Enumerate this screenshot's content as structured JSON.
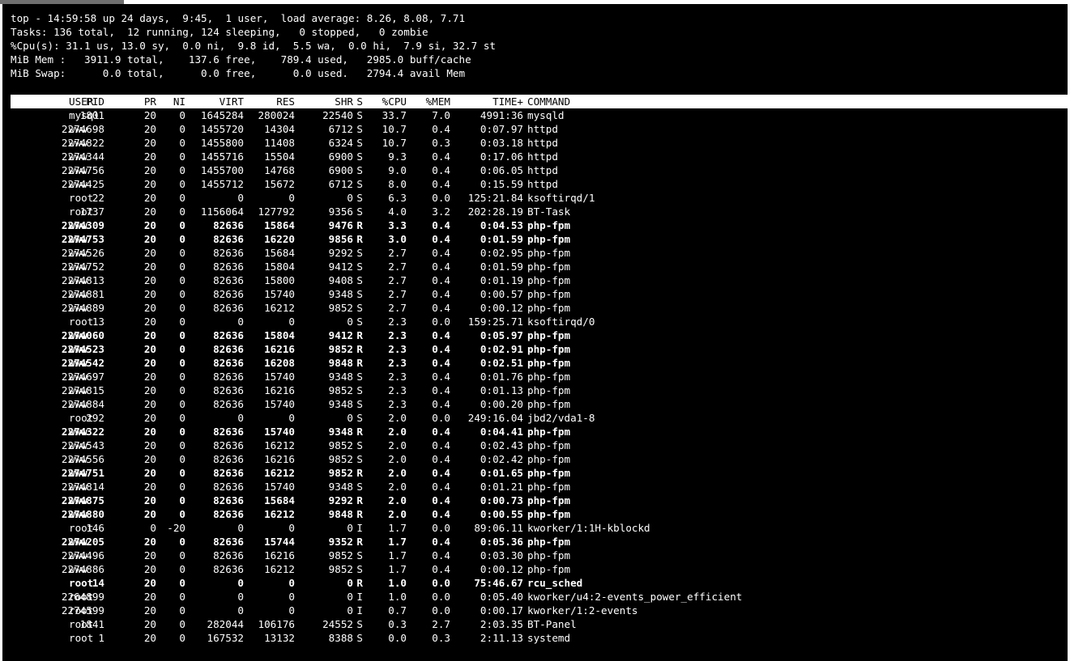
{
  "summary": {
    "uptime_line": "top - 14:59:58 up 24 days,  9:45,  1 user,  load average: 8.26, 8.08, 7.71",
    "tasks_line": "Tasks: 136 total,  12 running, 124 sleeping,   0 stopped,   0 zombie",
    "cpu_line": "%Cpu(s): 31.1 us, 13.0 sy,  0.0 ni,  9.8 id,  5.5 wa,  0.0 hi,  7.9 si, 32.7 st",
    "mem_line": "MiB Mem :   3911.9 total,    137.6 free,    789.4 used,   2985.0 buff/cache",
    "swap_line": "MiB Swap:      0.0 total,      0.0 free,      0.0 used.   2794.4 avail Mem"
  },
  "columns": {
    "pid": "PID",
    "user": "USER",
    "pr": "PR",
    "ni": "NI",
    "virt": "VIRT",
    "res": "RES",
    "shr": "SHR",
    "s": "S",
    "cpu": "%CPU",
    "mem": "%MEM",
    "time": "TIME+",
    "command": "COMMAND"
  },
  "processes": [
    {
      "pid": "1801",
      "user": "mysql",
      "pr": "20",
      "ni": "0",
      "virt": "1645284",
      "res": "280024",
      "shr": "22540",
      "s": "S",
      "cpu": "33.7",
      "mem": "7.0",
      "time": "4991:36",
      "command": "mysqld"
    },
    {
      "pid": "2274698",
      "user": "www",
      "pr": "20",
      "ni": "0",
      "virt": "1455720",
      "res": "14304",
      "shr": "6712",
      "s": "S",
      "cpu": "10.7",
      "mem": "0.4",
      "time": "0:07.97",
      "command": "httpd"
    },
    {
      "pid": "2274822",
      "user": "www",
      "pr": "20",
      "ni": "0",
      "virt": "1455800",
      "res": "11408",
      "shr": "6324",
      "s": "S",
      "cpu": "10.7",
      "mem": "0.3",
      "time": "0:03.18",
      "command": "httpd"
    },
    {
      "pid": "2274344",
      "user": "www",
      "pr": "20",
      "ni": "0",
      "virt": "1455716",
      "res": "15504",
      "shr": "6900",
      "s": "S",
      "cpu": "9.3",
      "mem": "0.4",
      "time": "0:17.06",
      "command": "httpd"
    },
    {
      "pid": "2274756",
      "user": "www",
      "pr": "20",
      "ni": "0",
      "virt": "1455700",
      "res": "14768",
      "shr": "6900",
      "s": "S",
      "cpu": "9.0",
      "mem": "0.4",
      "time": "0:06.05",
      "command": "httpd"
    },
    {
      "pid": "2274425",
      "user": "www",
      "pr": "20",
      "ni": "0",
      "virt": "1455712",
      "res": "15672",
      "shr": "6712",
      "s": "S",
      "cpu": "8.0",
      "mem": "0.4",
      "time": "0:15.59",
      "command": "httpd"
    },
    {
      "pid": "22",
      "user": "root",
      "pr": "20",
      "ni": "0",
      "virt": "0",
      "res": "0",
      "shr": "0",
      "s": "S",
      "cpu": "6.3",
      "mem": "0.0",
      "time": "125:21.84",
      "command": "ksoftirqd/1"
    },
    {
      "pid": "1737",
      "user": "root",
      "pr": "20",
      "ni": "0",
      "virt": "1156064",
      "res": "127792",
      "shr": "9356",
      "s": "S",
      "cpu": "4.0",
      "mem": "3.2",
      "time": "202:28.19",
      "command": "BT-Task"
    },
    {
      "pid": "2274309",
      "user": "www",
      "pr": "20",
      "ni": "0",
      "virt": "82636",
      "res": "15864",
      "shr": "9476",
      "s": "R",
      "cpu": "3.3",
      "mem": "0.4",
      "time": "0:04.53",
      "command": "php-fpm"
    },
    {
      "pid": "2274753",
      "user": "www",
      "pr": "20",
      "ni": "0",
      "virt": "82636",
      "res": "16220",
      "shr": "9856",
      "s": "R",
      "cpu": "3.0",
      "mem": "0.4",
      "time": "0:01.59",
      "command": "php-fpm"
    },
    {
      "pid": "2274526",
      "user": "www",
      "pr": "20",
      "ni": "0",
      "virt": "82636",
      "res": "15684",
      "shr": "9292",
      "s": "S",
      "cpu": "2.7",
      "mem": "0.4",
      "time": "0:02.95",
      "command": "php-fpm"
    },
    {
      "pid": "2274752",
      "user": "www",
      "pr": "20",
      "ni": "0",
      "virt": "82636",
      "res": "15804",
      "shr": "9412",
      "s": "S",
      "cpu": "2.7",
      "mem": "0.4",
      "time": "0:01.59",
      "command": "php-fpm"
    },
    {
      "pid": "2274813",
      "user": "www",
      "pr": "20",
      "ni": "0",
      "virt": "82636",
      "res": "15800",
      "shr": "9408",
      "s": "S",
      "cpu": "2.7",
      "mem": "0.4",
      "time": "0:01.19",
      "command": "php-fpm"
    },
    {
      "pid": "2274881",
      "user": "www",
      "pr": "20",
      "ni": "0",
      "virt": "82636",
      "res": "15740",
      "shr": "9348",
      "s": "S",
      "cpu": "2.7",
      "mem": "0.4",
      "time": "0:00.57",
      "command": "php-fpm"
    },
    {
      "pid": "2274889",
      "user": "www",
      "pr": "20",
      "ni": "0",
      "virt": "82636",
      "res": "16212",
      "shr": "9852",
      "s": "S",
      "cpu": "2.7",
      "mem": "0.4",
      "time": "0:00.12",
      "command": "php-fpm"
    },
    {
      "pid": "13",
      "user": "root",
      "pr": "20",
      "ni": "0",
      "virt": "0",
      "res": "0",
      "shr": "0",
      "s": "S",
      "cpu": "2.3",
      "mem": "0.0",
      "time": "159:25.71",
      "command": "ksoftirqd/0"
    },
    {
      "pid": "2274060",
      "user": "www",
      "pr": "20",
      "ni": "0",
      "virt": "82636",
      "res": "15804",
      "shr": "9412",
      "s": "R",
      "cpu": "2.3",
      "mem": "0.4",
      "time": "0:05.97",
      "command": "php-fpm"
    },
    {
      "pid": "2274523",
      "user": "www",
      "pr": "20",
      "ni": "0",
      "virt": "82636",
      "res": "16216",
      "shr": "9852",
      "s": "R",
      "cpu": "2.3",
      "mem": "0.4",
      "time": "0:02.91",
      "command": "php-fpm"
    },
    {
      "pid": "2274542",
      "user": "www",
      "pr": "20",
      "ni": "0",
      "virt": "82636",
      "res": "16208",
      "shr": "9848",
      "s": "R",
      "cpu": "2.3",
      "mem": "0.4",
      "time": "0:02.51",
      "command": "php-fpm"
    },
    {
      "pid": "2274697",
      "user": "www",
      "pr": "20",
      "ni": "0",
      "virt": "82636",
      "res": "15740",
      "shr": "9348",
      "s": "S",
      "cpu": "2.3",
      "mem": "0.4",
      "time": "0:01.76",
      "command": "php-fpm"
    },
    {
      "pid": "2274815",
      "user": "www",
      "pr": "20",
      "ni": "0",
      "virt": "82636",
      "res": "16216",
      "shr": "9852",
      "s": "S",
      "cpu": "2.3",
      "mem": "0.4",
      "time": "0:01.13",
      "command": "php-fpm"
    },
    {
      "pid": "2274884",
      "user": "www",
      "pr": "20",
      "ni": "0",
      "virt": "82636",
      "res": "15740",
      "shr": "9348",
      "s": "S",
      "cpu": "2.3",
      "mem": "0.4",
      "time": "0:00.20",
      "command": "php-fpm"
    },
    {
      "pid": "292",
      "user": "root",
      "pr": "20",
      "ni": "0",
      "virt": "0",
      "res": "0",
      "shr": "0",
      "s": "S",
      "cpu": "2.0",
      "mem": "0.0",
      "time": "249:16.04",
      "command": "jbd2/vda1-8"
    },
    {
      "pid": "2274322",
      "user": "www",
      "pr": "20",
      "ni": "0",
      "virt": "82636",
      "res": "15740",
      "shr": "9348",
      "s": "R",
      "cpu": "2.0",
      "mem": "0.4",
      "time": "0:04.41",
      "command": "php-fpm"
    },
    {
      "pid": "2274543",
      "user": "www",
      "pr": "20",
      "ni": "0",
      "virt": "82636",
      "res": "16212",
      "shr": "9852",
      "s": "S",
      "cpu": "2.0",
      "mem": "0.4",
      "time": "0:02.43",
      "command": "php-fpm"
    },
    {
      "pid": "2274556",
      "user": "www",
      "pr": "20",
      "ni": "0",
      "virt": "82636",
      "res": "16216",
      "shr": "9852",
      "s": "S",
      "cpu": "2.0",
      "mem": "0.4",
      "time": "0:02.42",
      "command": "php-fpm"
    },
    {
      "pid": "2274751",
      "user": "www",
      "pr": "20",
      "ni": "0",
      "virt": "82636",
      "res": "16212",
      "shr": "9852",
      "s": "R",
      "cpu": "2.0",
      "mem": "0.4",
      "time": "0:01.65",
      "command": "php-fpm"
    },
    {
      "pid": "2274814",
      "user": "www",
      "pr": "20",
      "ni": "0",
      "virt": "82636",
      "res": "15740",
      "shr": "9348",
      "s": "S",
      "cpu": "2.0",
      "mem": "0.4",
      "time": "0:01.21",
      "command": "php-fpm"
    },
    {
      "pid": "2274875",
      "user": "www",
      "pr": "20",
      "ni": "0",
      "virt": "82636",
      "res": "15684",
      "shr": "9292",
      "s": "R",
      "cpu": "2.0",
      "mem": "0.4",
      "time": "0:00.73",
      "command": "php-fpm"
    },
    {
      "pid": "2274880",
      "user": "www",
      "pr": "20",
      "ni": "0",
      "virt": "82636",
      "res": "16212",
      "shr": "9848",
      "s": "R",
      "cpu": "2.0",
      "mem": "0.4",
      "time": "0:00.55",
      "command": "php-fpm"
    },
    {
      "pid": "146",
      "user": "root",
      "pr": "0",
      "ni": "-20",
      "virt": "0",
      "res": "0",
      "shr": "0",
      "s": "I",
      "cpu": "1.7",
      "mem": "0.0",
      "time": "89:06.11",
      "command": "kworker/1:1H-kblockd"
    },
    {
      "pid": "2274205",
      "user": "www",
      "pr": "20",
      "ni": "0",
      "virt": "82636",
      "res": "15744",
      "shr": "9352",
      "s": "R",
      "cpu": "1.7",
      "mem": "0.4",
      "time": "0:05.36",
      "command": "php-fpm"
    },
    {
      "pid": "2274496",
      "user": "www",
      "pr": "20",
      "ni": "0",
      "virt": "82636",
      "res": "16216",
      "shr": "9852",
      "s": "S",
      "cpu": "1.7",
      "mem": "0.4",
      "time": "0:03.30",
      "command": "php-fpm"
    },
    {
      "pid": "2274886",
      "user": "www",
      "pr": "20",
      "ni": "0",
      "virt": "82636",
      "res": "16212",
      "shr": "9852",
      "s": "S",
      "cpu": "1.7",
      "mem": "0.4",
      "time": "0:00.12",
      "command": "php-fpm"
    },
    {
      "pid": "14",
      "user": "root",
      "pr": "20",
      "ni": "0",
      "virt": "0",
      "res": "0",
      "shr": "0",
      "s": "R",
      "cpu": "1.0",
      "mem": "0.0",
      "time": "75:46.67",
      "command": "rcu_sched"
    },
    {
      "pid": "2264899",
      "user": "root",
      "pr": "20",
      "ni": "0",
      "virt": "0",
      "res": "0",
      "shr": "0",
      "s": "I",
      "cpu": "1.0",
      "mem": "0.0",
      "time": "0:05.40",
      "command": "kworker/u4:2-events_power_efficient"
    },
    {
      "pid": "2274599",
      "user": "root",
      "pr": "20",
      "ni": "0",
      "virt": "0",
      "res": "0",
      "shr": "0",
      "s": "I",
      "cpu": "0.7",
      "mem": "0.0",
      "time": "0:00.17",
      "command": "kworker/1:2-events"
    },
    {
      "pid": "1841",
      "user": "root",
      "pr": "20",
      "ni": "0",
      "virt": "282044",
      "res": "106176",
      "shr": "24552",
      "s": "S",
      "cpu": "0.3",
      "mem": "2.7",
      "time": "2:03.35",
      "command": "BT-Panel"
    },
    {
      "pid": "1",
      "user": "root",
      "pr": "20",
      "ni": "0",
      "virt": "167532",
      "res": "13132",
      "shr": "8388",
      "s": "S",
      "cpu": "0.0",
      "mem": "0.3",
      "time": "2:11.13",
      "command": "systemd"
    }
  ]
}
